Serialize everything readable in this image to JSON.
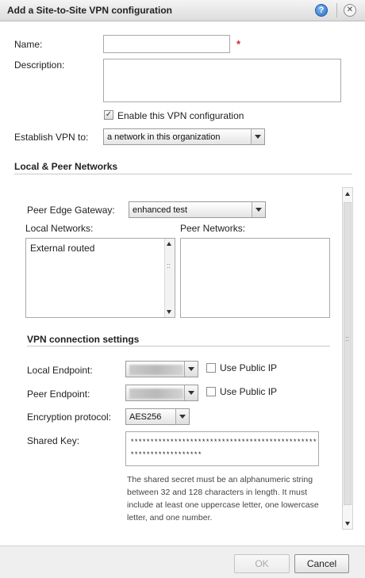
{
  "window": {
    "title": "Add a Site-to-Site VPN configuration",
    "help_glyph": "?",
    "close_glyph": "✕"
  },
  "form": {
    "name_label": "Name:",
    "name_value": "",
    "required_marker": "*",
    "description_label": "Description:",
    "description_value": "",
    "enable_label": "Enable this VPN configuration",
    "enable_checked": true,
    "establish_label": "Establish VPN to:",
    "establish_value": "a network in this organization"
  },
  "networks": {
    "header": "Local & Peer Networks",
    "peer_gateway_label": "Peer Edge Gateway:",
    "peer_gateway_value": "enhanced test",
    "local_label": "Local Networks:",
    "local_items": [
      "External routed"
    ],
    "peer_label": "Peer Networks:",
    "peer_items": []
  },
  "connection": {
    "header": "VPN connection settings",
    "local_endpoint_label": "Local Endpoint:",
    "local_public_ip_label": "Use Public IP",
    "peer_endpoint_label": "Peer Endpoint:",
    "peer_public_ip_label": "Use Public IP",
    "encryption_label": "Encryption protocol:",
    "encryption_value": "AES256",
    "shared_key_label": "Shared Key:",
    "shared_key_value": "*****************************************************************",
    "shared_key_hint": "The shared secret must be an alphanumeric string between 32 and 128 characters in length. It must include at least one uppercase letter, one lowercase letter, and one number."
  },
  "footer": {
    "ok_label": "OK",
    "cancel_label": "Cancel"
  },
  "colors": {
    "required": "#dd2233",
    "help_icon": "#2a6fc6"
  }
}
